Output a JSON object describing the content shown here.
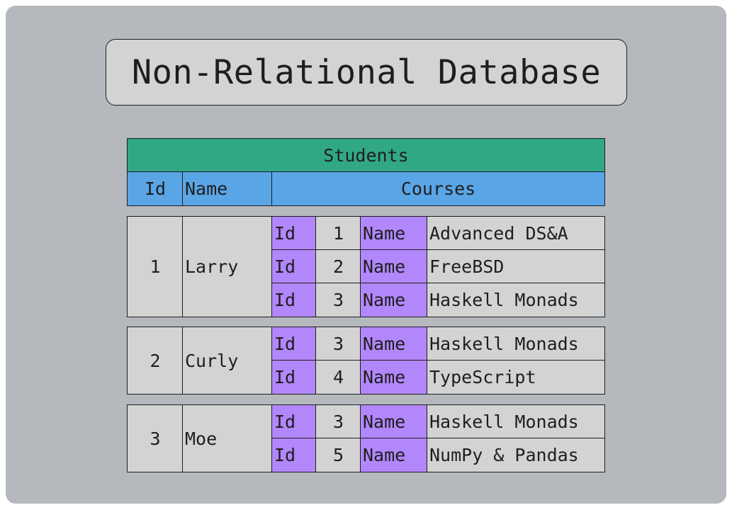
{
  "title": "Non-Relational Database",
  "table": {
    "name": "Students",
    "columns": [
      "Id",
      "Name",
      "Courses"
    ],
    "course_id_label": "Id",
    "course_name_label": "Name"
  },
  "students": [
    {
      "id": "1",
      "name": "Larry",
      "courses": [
        {
          "id": "1",
          "name": "Advanced DS&A"
        },
        {
          "id": "2",
          "name": "FreeBSD"
        },
        {
          "id": "3",
          "name": "Haskell Monads"
        }
      ]
    },
    {
      "id": "2",
      "name": "Curly",
      "courses": [
        {
          "id": "3",
          "name": "Haskell Monads"
        },
        {
          "id": "4",
          "name": "TypeScript"
        }
      ]
    },
    {
      "id": "3",
      "name": "Moe",
      "courses": [
        {
          "id": "3",
          "name": "Haskell Monads"
        },
        {
          "id": "5",
          "name": "NumPy & Pandas"
        }
      ]
    }
  ],
  "colors": {
    "background": "#b5b9be",
    "header_green": "#31a885",
    "header_blue": "#5aa5e6",
    "cell_gray": "#d3d3d3",
    "label_purple": "#b287fb"
  }
}
